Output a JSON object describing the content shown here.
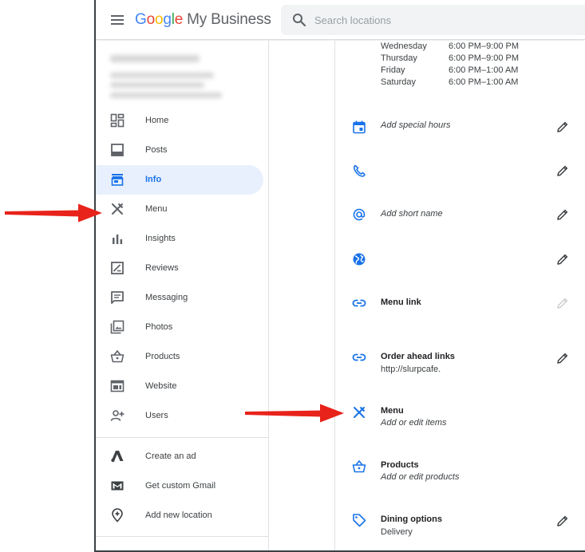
{
  "header": {
    "logo_google_letters": [
      "G",
      "o",
      "o",
      "g",
      "l",
      "e"
    ],
    "logo_google_colors": [
      "#4285F4",
      "#EA4335",
      "#FBBC05",
      "#4285F4",
      "#34A853",
      "#EA4335"
    ],
    "logo_suffix": "My Business",
    "search_placeholder": "Search locations"
  },
  "sidebar": {
    "items": [
      {
        "label": "Home",
        "icon": "dashboard-icon"
      },
      {
        "label": "Posts",
        "icon": "posts-icon"
      },
      {
        "label": "Info",
        "icon": "storefront-icon",
        "active": true
      },
      {
        "label": "Menu",
        "icon": "fork-knife-icon"
      },
      {
        "label": "Insights",
        "icon": "bar-chart-icon"
      },
      {
        "label": "Reviews",
        "icon": "reviews-icon"
      },
      {
        "label": "Messaging",
        "icon": "message-icon"
      },
      {
        "label": "Photos",
        "icon": "photos-icon"
      },
      {
        "label": "Products",
        "icon": "basket-icon"
      },
      {
        "label": "Website",
        "icon": "website-icon"
      },
      {
        "label": "Users",
        "icon": "add-user-icon"
      },
      {
        "label": "Create an ad",
        "icon": "google-ads-icon"
      },
      {
        "label": "Get custom Gmail",
        "icon": "gmail-icon"
      },
      {
        "label": "Add new location",
        "icon": "add-location-icon"
      }
    ]
  },
  "hours": [
    {
      "day": "Wednesday",
      "time": "6:00 PM–9:00 PM"
    },
    {
      "day": "Thursday",
      "time": "6:00 PM–9:00 PM"
    },
    {
      "day": "Friday",
      "time": "6:00 PM–1:00 AM"
    },
    {
      "day": "Saturday",
      "time": "6:00 PM–1:00 AM"
    }
  ],
  "info_rows": {
    "special_hours": {
      "text": "Add special hours",
      "icon": "calendar-icon"
    },
    "phone": {
      "icon": "phone-icon"
    },
    "short_name": {
      "text": "Add short name",
      "icon": "at-icon"
    },
    "website": {
      "icon": "globe-icon"
    },
    "menu_link": {
      "title": "Menu link",
      "icon": "link-icon"
    },
    "order_ahead": {
      "title": "Order ahead links",
      "text": "http://slurpcafe.",
      "icon": "link-icon"
    },
    "menu": {
      "title": "Menu",
      "text": "Add or edit items",
      "icon": "fork-knife-icon"
    },
    "products": {
      "title": "Products",
      "text": "Add or edit products",
      "icon": "basket-icon"
    },
    "dining": {
      "title": "Dining options",
      "text": "Delivery",
      "icon": "tag-icon"
    }
  },
  "colors": {
    "accent_blue": "#1a73e8",
    "active_bg": "#e8f0fe",
    "arrow_red": "#e8231b",
    "icon_gray": "#5f6368"
  }
}
